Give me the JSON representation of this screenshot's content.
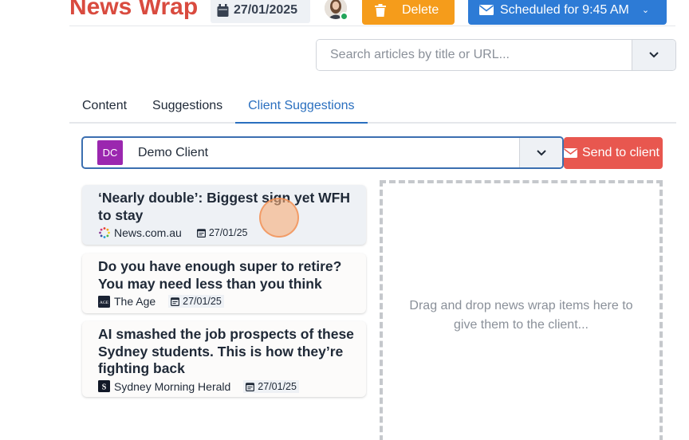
{
  "header": {
    "title": "News Wrap",
    "date": "27/01/2025",
    "delete_label": "Delete",
    "schedule_label": "Scheduled for 9:45 AM"
  },
  "search": {
    "placeholder": "Search articles by title or URL..."
  },
  "tabs": [
    {
      "label": "Content",
      "active": false
    },
    {
      "label": "Suggestions",
      "active": false
    },
    {
      "label": "Client Suggestions",
      "active": true
    }
  ],
  "client": {
    "initials": "DC",
    "name": "Demo Client",
    "badge_color": "#9b27af",
    "send_label": "Send to client"
  },
  "articles": [
    {
      "title": "‘Nearly double’: Biggest sign yet WFH to stay",
      "source": "News.com.au",
      "source_icon": "newscomau-logo-icon",
      "date": "27/01/25"
    },
    {
      "title": "Do you have enough super to retire? You may need less than you think",
      "source": "The Age",
      "source_icon": "the-age-logo-icon",
      "date": "27/01/25"
    },
    {
      "title": "AI smashed the job prospects of these Sydney students. This is how they’re fighting back",
      "source": "Sydney Morning Herald",
      "source_icon": "smh-logo-icon",
      "date": "27/01/25"
    }
  ],
  "dropzone": {
    "text": "Drag and drop news wrap items here to give them to the client..."
  },
  "colors": {
    "title_red": "#d94b3f",
    "delete_orange": "#f59c1b",
    "schedule_blue": "#2d7bd6",
    "send_red": "#e8574f",
    "active_tab": "#2a6fbf"
  }
}
